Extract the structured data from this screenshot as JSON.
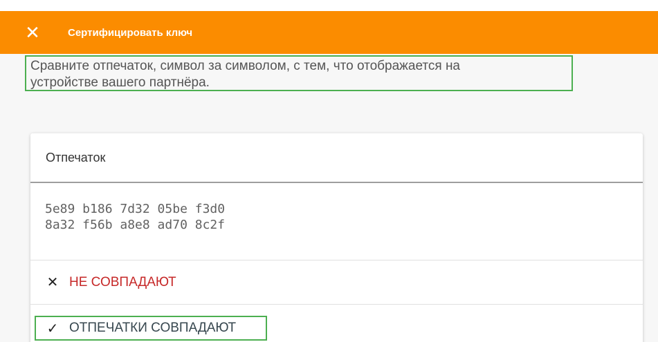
{
  "header": {
    "close_icon": "close-icon",
    "title": "Сертифицировать ключ"
  },
  "intro": {
    "text_line1": "Сравните отпечаток, символ за символом, с тем, что отображается на",
    "text_line2": "устройстве вашего партнёра."
  },
  "card": {
    "title": "Отпечаток",
    "fingerprint_line1": "5e89 b186 7d32 05be f3d0",
    "fingerprint_line2": "8a32 f56b a8e8 ad70 8c2f",
    "no_match": {
      "icon": "close-icon",
      "label": "НЕ СОВПАДАЮТ"
    },
    "match": {
      "icon": "check-icon",
      "label": "ОТПЕЧАТКИ СОВПАДАЮТ"
    }
  },
  "colors": {
    "appbar": "#fb8c00",
    "highlight_border": "#4caf50",
    "no_match_text": "#c62828"
  }
}
